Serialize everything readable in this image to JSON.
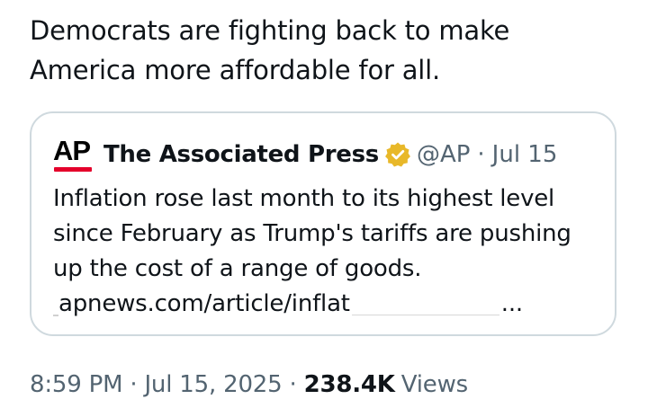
{
  "tweet": {
    "text": "Democrats are fighting back to make America more affordable for all."
  },
  "quote": {
    "logo_text": "AP",
    "author_name": "The Associated Press",
    "handle": "@AP",
    "separator": "·",
    "date": "Jul 15",
    "body": "Inflation rose last month to its highest level since February as Trump's tariffs are pushing up the cost of a range of goods.",
    "link": "apnews.com/article/inflat",
    "link_ellipsis": "...",
    "icons": {
      "verified": "verified-gold-badge-icon"
    },
    "colors": {
      "logo_bar": "#e4002b",
      "badge": "#e8b829"
    }
  },
  "meta": {
    "time": "8:59 PM",
    "separator": "·",
    "date": "Jul 15, 2025",
    "views_count": "238.4K",
    "views_label": "Views"
  }
}
